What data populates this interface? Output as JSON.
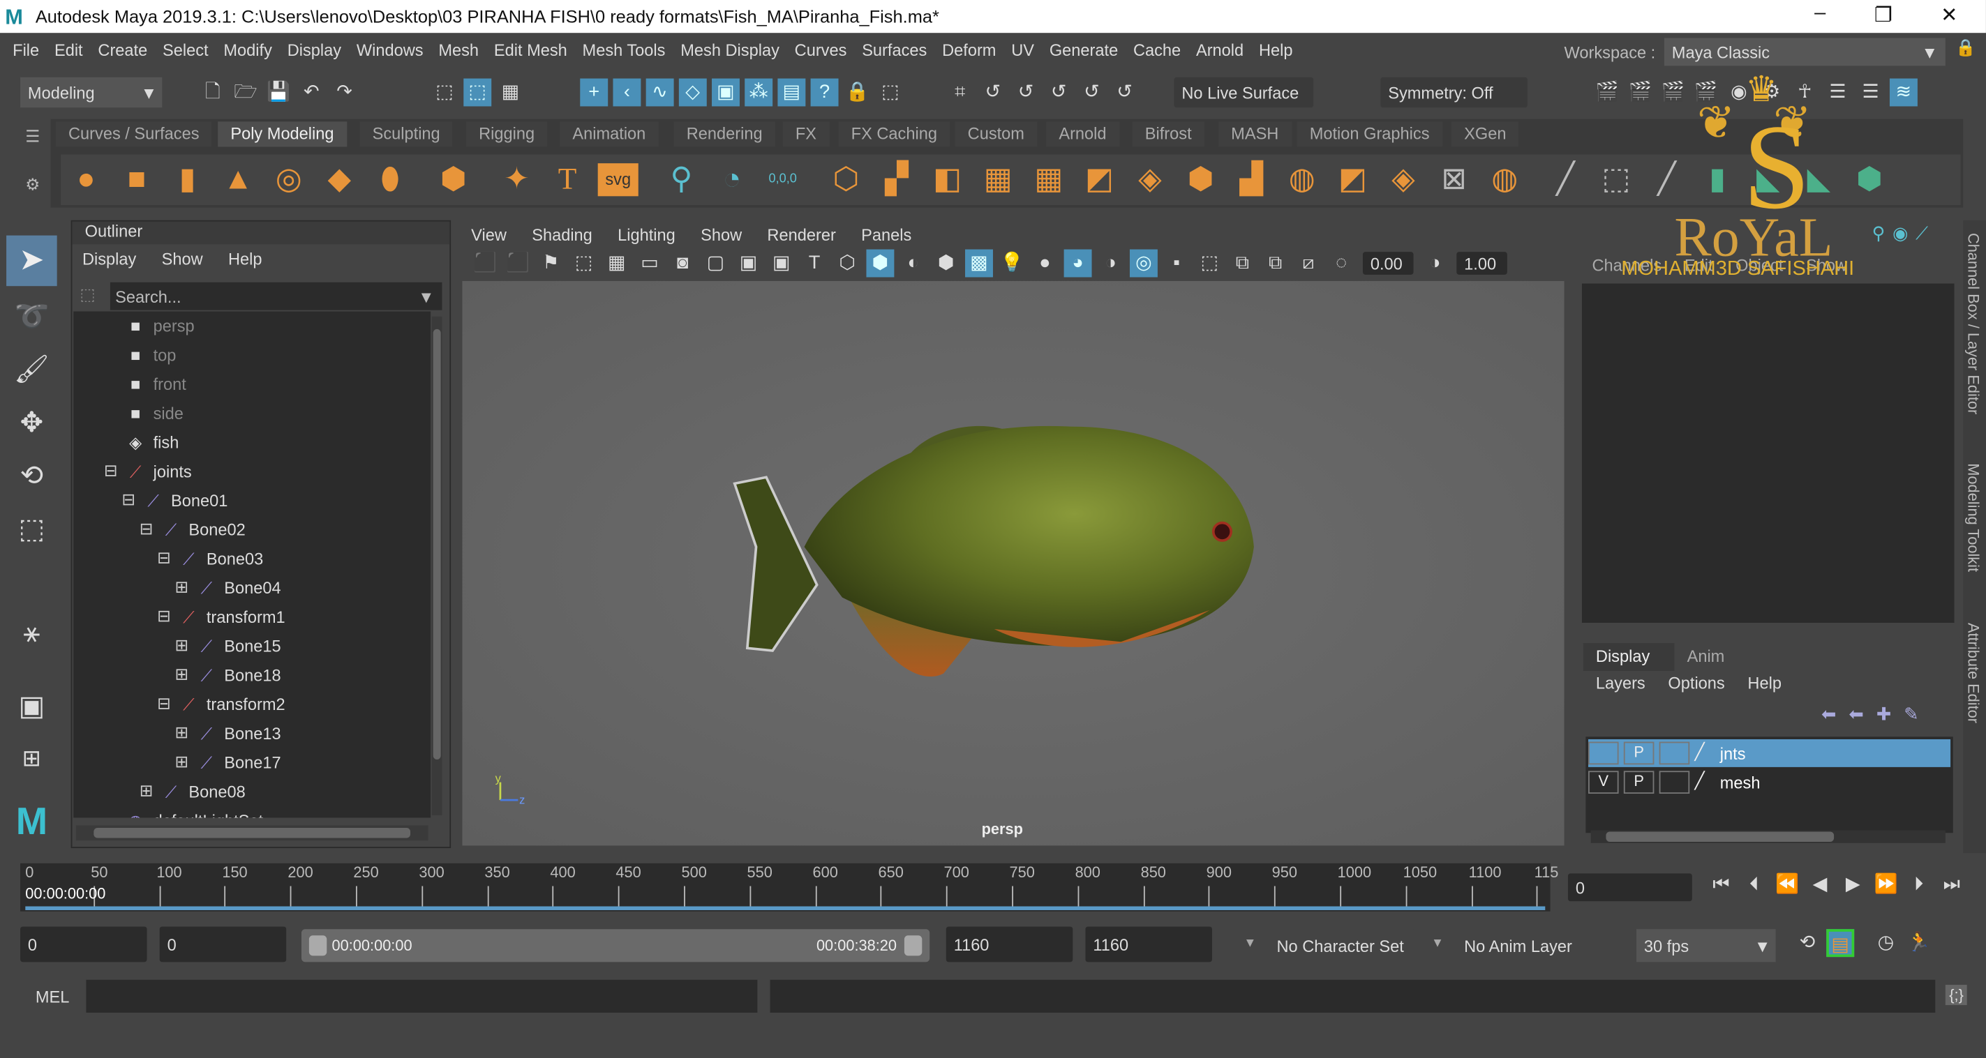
{
  "window": {
    "title": "Autodesk Maya 2019.3.1: C:\\Users\\lenovo\\Desktop\\03 PIRANHA FISH\\0 ready formats\\Fish_MA\\Piranha_Fish.ma*",
    "minimize": "–",
    "restore": "❐",
    "close": "✕",
    "app_icon": "M"
  },
  "menu": [
    "File",
    "Edit",
    "Create",
    "Select",
    "Modify",
    "Display",
    "Windows",
    "Mesh",
    "Edit Mesh",
    "Mesh Tools",
    "Mesh Display",
    "Curves",
    "Surfaces",
    "Deform",
    "UV",
    "Generate",
    "Cache",
    "Arnold",
    "Help"
  ],
  "workspace": {
    "label": "Workspace :",
    "value": "Maya Classic"
  },
  "status_line": {
    "mode": "Modeling",
    "live_surface": "No Live Surface",
    "symmetry": "Symmetry: Off"
  },
  "shelf_tabs": [
    "Curves / Surfaces",
    "Poly Modeling",
    "Sculpting",
    "Rigging",
    "Animation",
    "Rendering",
    "FX",
    "FX Caching",
    "Custom",
    "Arnold",
    "Bifrost",
    "MASH",
    "Motion Graphics",
    "XGen"
  ],
  "shelf_active": "Poly Modeling",
  "shelf_labels": {
    "text": "T",
    "svg": "svg",
    "origin": "0,0,0"
  },
  "outliner": {
    "title": "Outliner",
    "menu": [
      "Display",
      "Show",
      "Help"
    ],
    "search_placeholder": "Search...",
    "items": [
      {
        "label": "persp",
        "icon": "camera-icon",
        "depth": 0,
        "exp": "",
        "dim": true
      },
      {
        "label": "top",
        "icon": "camera-icon",
        "depth": 0,
        "exp": "",
        "dim": true
      },
      {
        "label": "front",
        "icon": "camera-icon",
        "depth": 0,
        "exp": "",
        "dim": true
      },
      {
        "label": "side",
        "icon": "camera-icon",
        "depth": 0,
        "exp": "",
        "dim": true
      },
      {
        "label": "fish",
        "icon": "mesh-icon",
        "depth": 0,
        "exp": ""
      },
      {
        "label": "joints",
        "icon": "transform-icon",
        "depth": 0,
        "exp": "⊟"
      },
      {
        "label": "Bone01",
        "icon": "joint-icon",
        "depth": 1,
        "exp": "⊟"
      },
      {
        "label": "Bone02",
        "icon": "joint-icon",
        "depth": 2,
        "exp": "⊟"
      },
      {
        "label": "Bone03",
        "icon": "joint-icon",
        "depth": 3,
        "exp": "⊟"
      },
      {
        "label": "Bone04",
        "icon": "joint-icon",
        "depth": 4,
        "exp": "⊞"
      },
      {
        "label": "transform1",
        "icon": "transform-icon",
        "depth": 3,
        "exp": "⊟"
      },
      {
        "label": "Bone15",
        "icon": "joint-icon",
        "depth": 4,
        "exp": "⊞"
      },
      {
        "label": "Bone18",
        "icon": "joint-icon",
        "depth": 4,
        "exp": "⊞"
      },
      {
        "label": "transform2",
        "icon": "transform-icon",
        "depth": 3,
        "exp": "⊟"
      },
      {
        "label": "Bone13",
        "icon": "joint-icon",
        "depth": 4,
        "exp": "⊞"
      },
      {
        "label": "Bone17",
        "icon": "joint-icon",
        "depth": 4,
        "exp": "⊞"
      },
      {
        "label": "Bone08",
        "icon": "joint-icon",
        "depth": 2,
        "exp": "⊞"
      },
      {
        "label": "defaultLightSet",
        "icon": "set-icon",
        "depth": 0,
        "exp": ""
      }
    ]
  },
  "viewport": {
    "menu": [
      "View",
      "Shading",
      "Lighting",
      "Show",
      "Renderer",
      "Panels"
    ],
    "exposure": "0.00",
    "gamma": "1.00",
    "camera": "persp",
    "axis_y": "y",
    "axis_z": "z"
  },
  "channel_box": {
    "menu": [
      "Channels",
      "Edit",
      "Object",
      "Show"
    ],
    "vertical_tabs": [
      "Channel Box / Layer Editor",
      "Modeling Toolkit",
      "Attribute Editor"
    ]
  },
  "layer_editor": {
    "tabs": [
      "Display",
      "Anim"
    ],
    "active_tab": "Display",
    "menu": [
      "Layers",
      "Options",
      "Help"
    ],
    "layers": [
      {
        "v": "",
        "p": "P",
        "name": "jnts",
        "selected": true
      },
      {
        "v": "V",
        "p": "P",
        "name": "mesh",
        "selected": false
      }
    ]
  },
  "timeline": {
    "ticks": [
      "0",
      "50",
      "100",
      "150",
      "200",
      "250",
      "300",
      "350",
      "400",
      "450",
      "500",
      "550",
      "600",
      "650",
      "700",
      "750",
      "800",
      "850",
      "900",
      "950",
      "1000",
      "1050",
      "1100",
      "115"
    ],
    "current_time": "00:00:00:00",
    "current_frame": "0"
  },
  "range": {
    "start": "0",
    "inner_start": "0",
    "slider_start": "00:00:00:00",
    "slider_end": "00:00:38:20",
    "inner_end": "1160",
    "end": "1160",
    "character_set": "No Character Set",
    "anim_layer": "No Anim Layer",
    "fps": "30 fps"
  },
  "command_line": {
    "label": "MEL"
  },
  "watermark": {
    "title": "RoYaL",
    "subtitle": "MOHAMM3D SAFISHAHI",
    "letter": "S"
  },
  "colors": {
    "accent": "#4a90b8",
    "shelf_orange": "#e8953a",
    "bg": "#444444"
  }
}
